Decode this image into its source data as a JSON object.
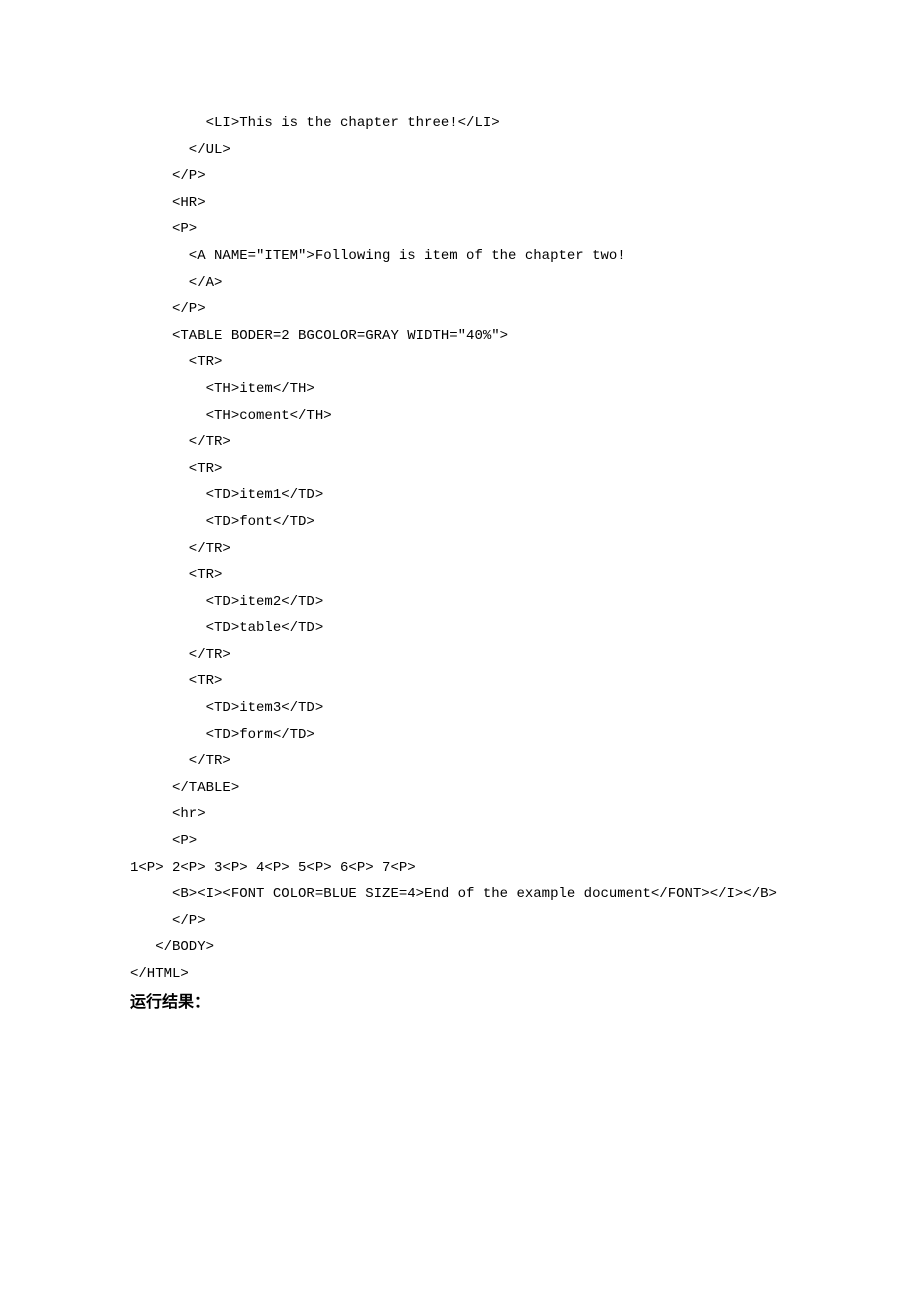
{
  "lines": [
    "         <LI>This is the chapter three!</LI>",
    "       </UL>",
    "     </P>",
    "     <HR>",
    "     <P>",
    "       <A NAME=\"ITEM\">Following is item of the chapter two!",
    "       </A>",
    "     </P>",
    "     <TABLE BODER=2 BGCOLOR=GRAY WIDTH=\"40%\">",
    "       <TR>",
    "         <TH>item</TH>",
    "         <TH>coment</TH>",
    "       </TR>",
    "       <TR>",
    "         <TD>item1</TD>",
    "         <TD>font</TD>",
    "       </TR>",
    "       <TR>",
    "         <TD>item2</TD>",
    "         <TD>table</TD>",
    "       </TR>",
    "       <TR>",
    "         <TD>item3</TD>",
    "         <TD>form</TD>",
    "       </TR>",
    "     </TABLE>",
    "     <hr>",
    "     <P>",
    "1<P> 2<P> 3<P> 4<P> 5<P> 6<P> 7<P>",
    "     <B><I><FONT COLOR=BLUE SIZE=4>End of the example document</FONT></I></B>",
    "     </P>",
    "   </BODY>",
    "</HTML>"
  ],
  "result_heading": "运行结果："
}
